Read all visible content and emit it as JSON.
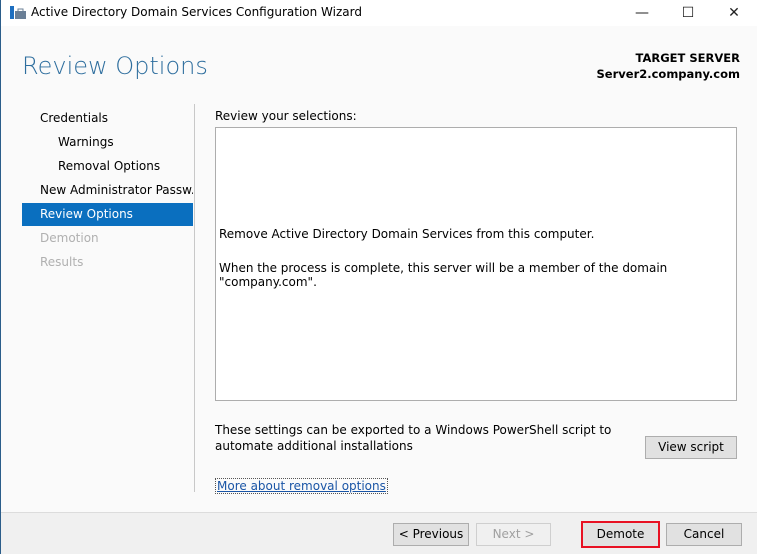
{
  "window": {
    "title": "Active Directory Domain Services Configuration Wizard",
    "minimize": "—",
    "maximize": "☐",
    "close": "✕"
  },
  "header": {
    "page_title": "Review Options",
    "target_label": "TARGET SERVER",
    "target_value": "Server2.company.com"
  },
  "nav": [
    {
      "label": "Credentials",
      "state": "normal"
    },
    {
      "label": "Warnings",
      "state": "sub"
    },
    {
      "label": "Removal Options",
      "state": "sub"
    },
    {
      "label": "New Administrator Passw...",
      "state": "normal"
    },
    {
      "label": "Review Options",
      "state": "selected"
    },
    {
      "label": "Demotion",
      "state": "disabled"
    },
    {
      "label": "Results",
      "state": "disabled"
    }
  ],
  "main": {
    "review_label": "Review your selections:",
    "lines": [
      "Remove Active Directory Domain Services from this computer.",
      "When the process is complete, this server will be a member of the domain \"company.com\"."
    ],
    "export_text": "These settings can be exported to a Windows PowerShell script to automate additional installations",
    "view_script": "View script",
    "more_link": "More about removal options"
  },
  "footer": {
    "previous": "< Previous",
    "next": "Next >",
    "demote": "Demote",
    "cancel": "Cancel",
    "highlight_color": "#e81123"
  }
}
